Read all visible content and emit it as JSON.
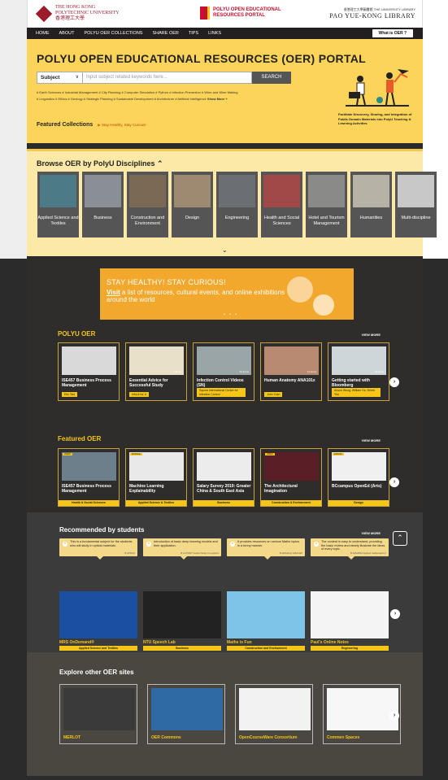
{
  "header": {
    "uni_line1": "THE HONG KONG",
    "uni_line2": "POLYTECHNIC UNIVERSITY",
    "uni_line3": "香港理工大學",
    "portal_line1": "POLYU OPEN EDUCATIONAL",
    "portal_line2": "RESOURCES PORTAL",
    "lib_line1": "香港理工大學圖書館 THE UNIVERSITY LIBRARY",
    "lib_line2": "PAO YUE-KONG LIBRARY"
  },
  "nav": {
    "items": [
      "HOME",
      "ABOUT",
      "POLYU OER COLLECTIONS",
      "SHARE OER",
      "TIPS",
      "LINKS"
    ],
    "what_is": "What is OER ?"
  },
  "hero": {
    "title": "POLYU OPEN EDUCATIONAL RESOURCES (OER) PORTAL",
    "subject": "Subject",
    "search_placeholder": "Input subject related keywords here...",
    "search_button": "SEARCH",
    "tags_line1": "# Earth Sciences  # Industrial Management  # City Planning  # Computer Simulation  # Python  # Infection Prevention  # Wine and Wine Making",
    "tags_line2": "# Linguistics  # Ethics  # Geology  # Strategic Planning  # Sustainable Development  # Architecture  # Artificial Intelligence",
    "show_more": "Show More +",
    "featured_label": "Featured Collections",
    "featured_link": "Stay Healthy, Stay Curious!",
    "caption": "Facilitate Discovery, Sharing, and Integration of Public Domain Materials into PolyU Teaching & Learning Activities"
  },
  "browse": {
    "title": "Browse OER by PolyU Disciplines ⌃",
    "disciplines": [
      {
        "label": "Applied Science and Textiles",
        "color": "#4c7a86"
      },
      {
        "label": "Business",
        "color": "#8a8f96"
      },
      {
        "label": "Construction and Environment",
        "color": "#7a6a55"
      },
      {
        "label": "Design",
        "color": "#9e8a70"
      },
      {
        "label": "Engineering",
        "color": "#6b6e72"
      },
      {
        "label": "Health and Social Sciences",
        "color": "#a14848"
      },
      {
        "label": "Hotel and Tourism Management",
        "color": "#8a8a88"
      },
      {
        "label": "Humanities",
        "color": "#b7b2a6"
      },
      {
        "label": "Multi-discipline",
        "color": "#c8c8c8"
      }
    ]
  },
  "banner": {
    "line1": "STAY HEALTHY! STAY CURIOUS!",
    "visit": "Visit",
    "line2": " a list of resources, cultural events, and online exhibitions around the world",
    "dots": "• • •"
  },
  "polyu_oer": {
    "title": "POLYU OER",
    "view_more": "VIEW MORE",
    "cards": [
      {
        "title": "ISE457 Business Process Management",
        "author": "Eric Tsui",
        "count": "",
        "color": "#d9d9d9"
      },
      {
        "title": "Essential Advice for Successful Study",
        "author": "InfoLit for U",
        "count": "5 items",
        "color": "#e8e0c8"
      },
      {
        "title": "Infection Control Videos (SN)",
        "author": "Squina International Centre for Infection Control",
        "count": "43 items",
        "color": "#9aa5a8"
      },
      {
        "title": "Human Anatomy ANA101x",
        "author": "John Yuen",
        "count": "11 items",
        "color": "#b98a72"
      },
      {
        "title": "Getting started with Bloomberg",
        "author": "Anson Wong, William Ho, Derek Yim",
        "count": "10 items",
        "color": "#cfd6da"
      }
    ]
  },
  "featured_oer": {
    "title": "Featured OER",
    "view_more": "VIEW MORE",
    "cards": [
      {
        "title": "ISE457 Business Process Management",
        "badge": "VIDEO",
        "category": "Health & Social Sciences",
        "color": "#6c7f8a"
      },
      {
        "title": "Machine Learning Explainability",
        "badge": "MODULE",
        "category": "Applied Science & Textiles",
        "color": "#e9e9e9"
      },
      {
        "title": "Salary Survey 2019: Greater China & South East Asia",
        "badge": "",
        "category": "Business",
        "color": "#ececec"
      },
      {
        "title": "The Architectural Imagination",
        "badge": "VIDEO",
        "category": "Construction & Environment",
        "color": "#5a1e26"
      },
      {
        "title": "BCcampus OpenEd (Arts)",
        "badge": "E-BOOK",
        "category": "Design",
        "color": "#f0f0f0"
      }
    ]
  },
  "recommended": {
    "title": "Recommended by students",
    "view_more": "VIEW MORE",
    "comments": [
      {
        "text": "This is a fundamental subject for the students who will study in optical materials.",
        "source": "★ AP4013"
      },
      {
        "text": "Introduction of basic deep learning models and their application.",
        "source": "★ LGT4097 Guided Study in Logistics"
      },
      {
        "text": "It provides resources on various Maths topics in a funny manner.",
        "source": "★ AMA1110, AMA1120"
      },
      {
        "text": "The content is easy to understand, providing the basic review and clearly illustrate the ideas of every topic.",
        "source": "★ AMA2512 Applied mathematics II"
      }
    ],
    "cards": [
      {
        "title": "MRS OnDemand®",
        "category": "Applied Science and Textiles",
        "color": "#1b4fa0"
      },
      {
        "title": "NTU Speech Lab",
        "category": "Business",
        "color": "#222222"
      },
      {
        "title": "Maths is Fun",
        "category": "Construction and Environment",
        "color": "#7ec4e8"
      },
      {
        "title": "Paul's Online Notes",
        "category": "Engineering",
        "color": "#f4f4f4"
      }
    ]
  },
  "explore": {
    "title": "Explore other OER sites",
    "cards": [
      {
        "title": "MERLOT",
        "color": "#3a3a3a"
      },
      {
        "title": "OER Commons",
        "color": "#2f6aa5"
      },
      {
        "title": "OpenCourseWare Consortium",
        "color": "#f2f2f2"
      },
      {
        "title": "Commen Spaces",
        "color": "#f7f7f7"
      }
    ]
  }
}
